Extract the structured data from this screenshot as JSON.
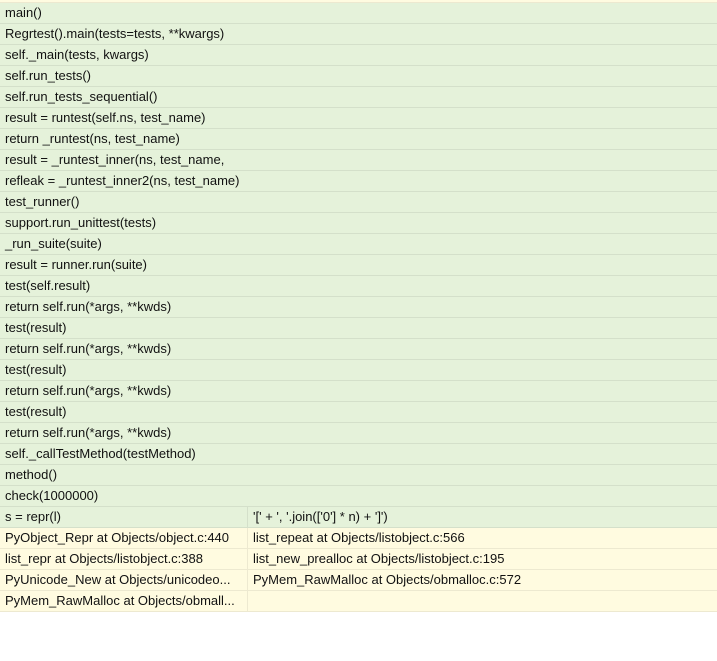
{
  "rows": [
    {
      "type": "single",
      "cls": "green",
      "text": "main()"
    },
    {
      "type": "single",
      "cls": "green",
      "text": "Regrtest().main(tests=tests, **kwargs)"
    },
    {
      "type": "single",
      "cls": "green",
      "text": "self._main(tests, kwargs)"
    },
    {
      "type": "single",
      "cls": "green",
      "text": "self.run_tests()"
    },
    {
      "type": "single",
      "cls": "green",
      "text": "self.run_tests_sequential()"
    },
    {
      "type": "single",
      "cls": "green",
      "text": "result = runtest(self.ns, test_name)"
    },
    {
      "type": "single",
      "cls": "green",
      "text": "return _runtest(ns, test_name)"
    },
    {
      "type": "single",
      "cls": "green",
      "text": "result = _runtest_inner(ns, test_name,"
    },
    {
      "type": "single",
      "cls": "green",
      "text": "refleak = _runtest_inner2(ns, test_name)"
    },
    {
      "type": "single",
      "cls": "green",
      "text": "test_runner()"
    },
    {
      "type": "single",
      "cls": "green",
      "text": "support.run_unittest(tests)"
    },
    {
      "type": "single",
      "cls": "green",
      "text": "_run_suite(suite)"
    },
    {
      "type": "single",
      "cls": "green",
      "text": "result = runner.run(suite)"
    },
    {
      "type": "single",
      "cls": "green",
      "text": "test(self.result)"
    },
    {
      "type": "single",
      "cls": "green",
      "text": "return self.run(*args, **kwds)"
    },
    {
      "type": "single",
      "cls": "green",
      "text": "test(result)"
    },
    {
      "type": "single",
      "cls": "green",
      "text": "return self.run(*args, **kwds)"
    },
    {
      "type": "single",
      "cls": "green",
      "text": "test(result)"
    },
    {
      "type": "single",
      "cls": "green",
      "text": "return self.run(*args, **kwds)"
    },
    {
      "type": "single",
      "cls": "green",
      "text": "test(result)"
    },
    {
      "type": "single",
      "cls": "green",
      "text": "return self.run(*args, **kwds)"
    },
    {
      "type": "single",
      "cls": "green",
      "text": "self._callTestMethod(testMethod)"
    },
    {
      "type": "single",
      "cls": "green",
      "text": "method()"
    },
    {
      "type": "single",
      "cls": "green",
      "text": "check(1000000)"
    },
    {
      "type": "split",
      "cls": "green",
      "left": "s = repr(l)",
      "right": "'[' + ', '.join(['0'] * n) + ']')"
    },
    {
      "type": "split",
      "cls": "yellow",
      "left": "PyObject_Repr at Objects/object.c:440",
      "right": "list_repeat at Objects/listobject.c:566"
    },
    {
      "type": "split",
      "cls": "yellow",
      "left": "list_repr at Objects/listobject.c:388",
      "right": "list_new_prealloc at Objects/listobject.c:195"
    },
    {
      "type": "split",
      "cls": "yellow",
      "left": "PyUnicode_New at Objects/unicodeo...",
      "right": "PyMem_RawMalloc at Objects/obmalloc.c:572"
    },
    {
      "type": "split",
      "cls": "yellow",
      "left": "PyMem_RawMalloc at Objects/obmall...",
      "right": ""
    }
  ]
}
